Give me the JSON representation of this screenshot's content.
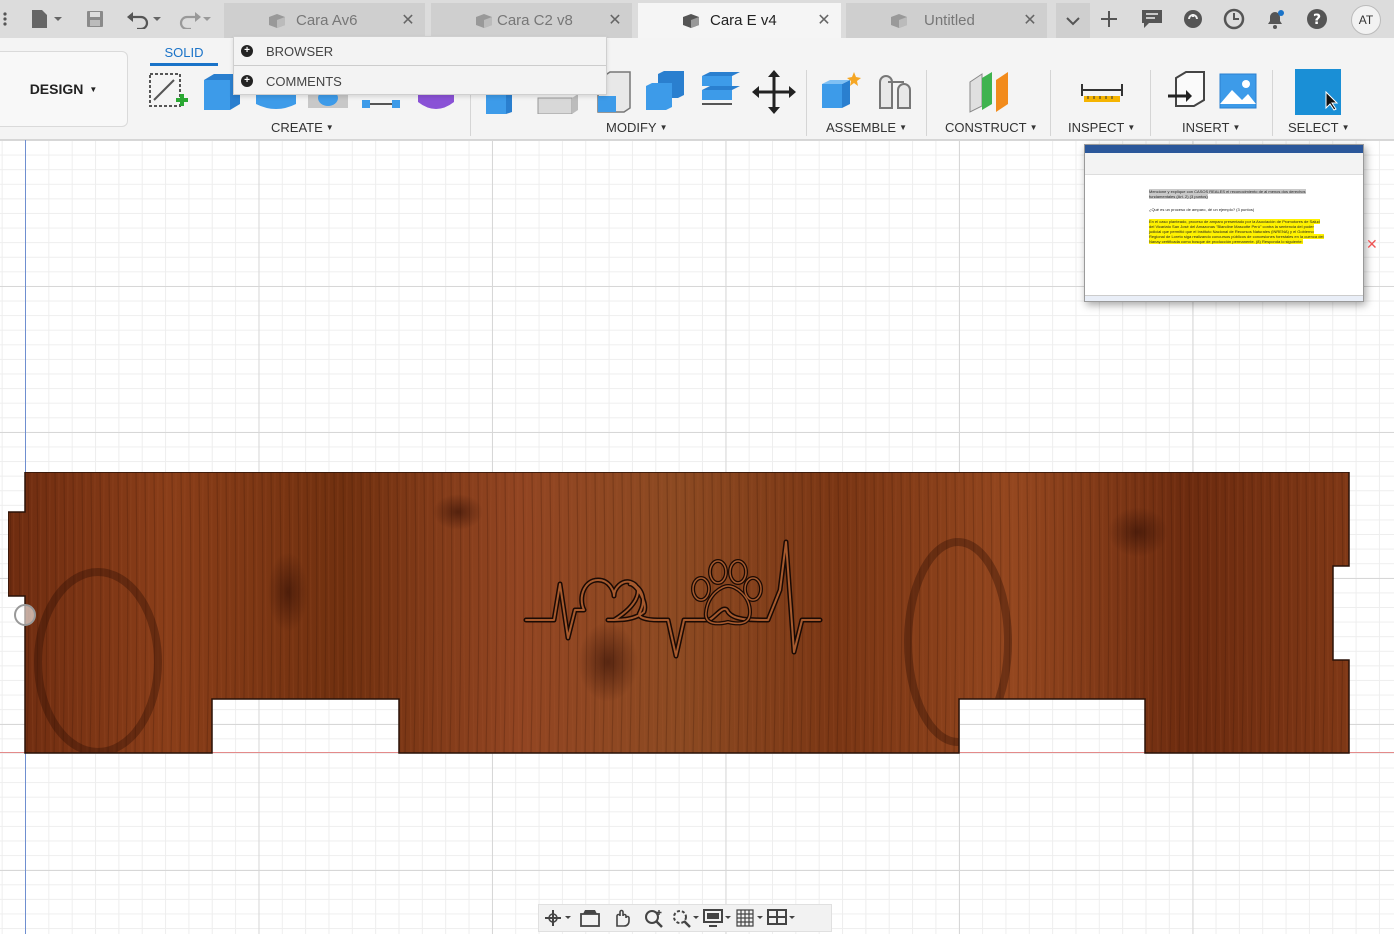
{
  "tabs": [
    {
      "label": "Cara Av6",
      "active": false
    },
    {
      "label": "Cara C2 v8",
      "active": false
    },
    {
      "label": "Cara E v4",
      "active": true
    },
    {
      "label": "Untitled",
      "active": false
    }
  ],
  "user": {
    "initials": "AT"
  },
  "workspace": {
    "label": "DESIGN"
  },
  "toolbar": {
    "solid_tab": "SOLID",
    "groups": {
      "create": "CREATE",
      "modify": "MODIFY",
      "assemble": "ASSEMBLE",
      "construct": "CONSTRUCT",
      "inspect": "INSPECT",
      "insert": "INSERT",
      "select": "SELECT"
    }
  },
  "panel_menu": {
    "browser": "BROWSER",
    "comments": "COMMENTS"
  },
  "thumbnail": {
    "item4": "Mencione y explique con CASOS REALES el reconocimiento de al menos dos derechos fundamentales (Art. 2) (3 puntos)",
    "item5": "¿Qué es un proceso de amparo, dé un ejemplo? (3 puntos)",
    "item6": "En el caso planteado, proceso de amparo presentado por la Asociación de Promotores de Salud del Vicariato San José del Amazonas \"Blandine Mascotte Perú\" contra la sentencia del poder judicial que permitió que el Instituto Nacional de Recursos Naturales (INRENA) y el Gobierno Regional de Loreto siga realizando concursos públicos de concesiones forestales en la cuenca del Nanay certificada como bosque de producción permanente. (8) Responda lo siguiente:"
  },
  "colors": {
    "accent": "#1a73c8",
    "wood_base": "#7a3414",
    "axis_x": "#e48a8a",
    "axis_y": "#6f8fd0",
    "select_icon": "#1a8fd6"
  }
}
